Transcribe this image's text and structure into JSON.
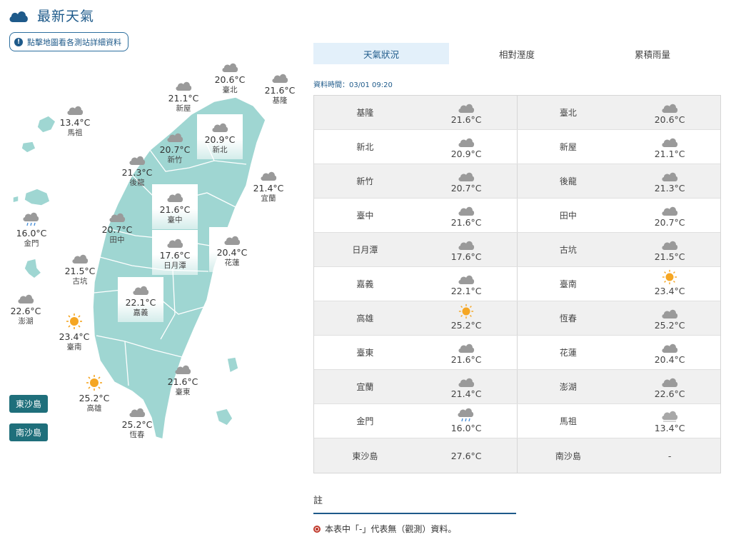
{
  "header": {
    "title": "最新天氣",
    "map_hint": "點擊地圖看各測站詳細資料"
  },
  "colors": {
    "accent": "#1e5a8a",
    "land": "#9fd6d2",
    "island_button": "#1f6f7b",
    "sun": "#f5a623",
    "cloud": "#9a9a9a"
  },
  "map": {
    "stations": [
      {
        "name": "臺北",
        "temp": "20.6°C",
        "icon": "cloud-icon"
      },
      {
        "name": "新屋",
        "temp": "21.1°C",
        "icon": "cloud-icon"
      },
      {
        "name": "基隆",
        "temp": "21.6°C",
        "icon": "cloud-icon"
      },
      {
        "name": "馬祖",
        "temp": "13.4°C",
        "icon": "cloud-icon"
      },
      {
        "name": "新北",
        "temp": "20.9°C",
        "icon": "cloud-icon"
      },
      {
        "name": "新竹",
        "temp": "20.7°C",
        "icon": "cloud-icon"
      },
      {
        "name": "後龍",
        "temp": "21.3°C",
        "icon": "cloud-icon"
      },
      {
        "name": "宜蘭",
        "temp": "21.4°C",
        "icon": "cloud-icon"
      },
      {
        "name": "臺中",
        "temp": "21.6°C",
        "icon": "cloud-icon"
      },
      {
        "name": "金門",
        "temp": "16.0°C",
        "icon": "rain-cloud-icon"
      },
      {
        "name": "田中",
        "temp": "20.7°C",
        "icon": "cloud-icon"
      },
      {
        "name": "日月潭",
        "temp": "17.6°C",
        "icon": "cloud-icon"
      },
      {
        "name": "花蓮",
        "temp": "20.4°C",
        "icon": "cloud-icon"
      },
      {
        "name": "古坑",
        "temp": "21.5°C",
        "icon": "cloud-icon"
      },
      {
        "name": "嘉義",
        "temp": "22.1°C",
        "icon": "cloud-icon"
      },
      {
        "name": "澎湖",
        "temp": "22.6°C",
        "icon": "cloud-icon"
      },
      {
        "name": "臺南",
        "temp": "23.4°C",
        "icon": "sun-icon"
      },
      {
        "name": "臺東",
        "temp": "21.6°C",
        "icon": "cloud-icon"
      },
      {
        "name": "高雄",
        "temp": "25.2°C",
        "icon": "sun-icon"
      },
      {
        "name": "恆春",
        "temp": "25.2°C",
        "icon": "cloud-icon"
      }
    ],
    "island_buttons": [
      "東沙島",
      "南沙島"
    ]
  },
  "tabs": [
    {
      "label": "天氣狀況",
      "active": true
    },
    {
      "label": "相對溼度",
      "active": false
    },
    {
      "label": "累積雨量",
      "active": false
    }
  ],
  "data_time": "資料時間：03/01 09:20",
  "table": [
    [
      {
        "name": "基隆",
        "temp": "21.6°C",
        "icon": "cloud-icon"
      },
      {
        "name": "臺北",
        "temp": "20.6°C",
        "icon": "cloud-icon"
      }
    ],
    [
      {
        "name": "新北",
        "temp": "20.9°C",
        "icon": "cloud-icon"
      },
      {
        "name": "新屋",
        "temp": "21.1°C",
        "icon": "cloud-icon"
      }
    ],
    [
      {
        "name": "新竹",
        "temp": "20.7°C",
        "icon": "cloud-icon"
      },
      {
        "name": "後龍",
        "temp": "21.3°C",
        "icon": "cloud-icon"
      }
    ],
    [
      {
        "name": "臺中",
        "temp": "21.6°C",
        "icon": "cloud-icon"
      },
      {
        "name": "田中",
        "temp": "20.7°C",
        "icon": "cloud-icon"
      }
    ],
    [
      {
        "name": "日月潭",
        "temp": "17.6°C",
        "icon": "cloud-icon"
      },
      {
        "name": "古坑",
        "temp": "21.5°C",
        "icon": "cloud-icon"
      }
    ],
    [
      {
        "name": "嘉義",
        "temp": "22.1°C",
        "icon": "cloud-icon"
      },
      {
        "name": "臺南",
        "temp": "23.4°C",
        "icon": "sun-icon"
      }
    ],
    [
      {
        "name": "高雄",
        "temp": "25.2°C",
        "icon": "sun-icon"
      },
      {
        "name": "恆春",
        "temp": "25.2°C",
        "icon": "cloud-icon"
      }
    ],
    [
      {
        "name": "臺東",
        "temp": "21.6°C",
        "icon": "cloud-icon"
      },
      {
        "name": "花蓮",
        "temp": "20.4°C",
        "icon": "cloud-icon"
      }
    ],
    [
      {
        "name": "宜蘭",
        "temp": "21.4°C",
        "icon": "cloud-icon"
      },
      {
        "name": "澎湖",
        "temp": "22.6°C",
        "icon": "cloud-icon"
      }
    ],
    [
      {
        "name": "金門",
        "temp": "16.0°C",
        "icon": "rain-cloud-icon"
      },
      {
        "name": "馬祖",
        "temp": "13.4°C",
        "icon": "fog-cloud-icon"
      }
    ],
    [
      {
        "name": "東沙島",
        "temp": "27.6°C",
        "icon": ""
      },
      {
        "name": "南沙島",
        "temp": "-",
        "icon": ""
      }
    ]
  ],
  "notes": {
    "title": "註",
    "lines": [
      "本表中「-」代表無（觀測）資料。"
    ]
  }
}
